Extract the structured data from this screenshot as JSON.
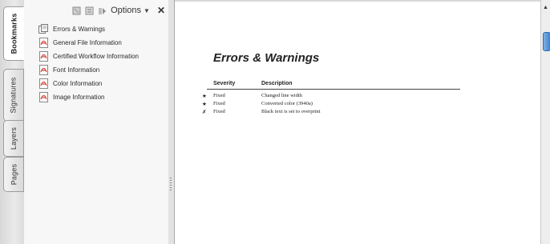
{
  "tabs": [
    {
      "label": "Bookmarks",
      "active": true
    },
    {
      "label": "Signatures",
      "active": false
    },
    {
      "label": "Layers",
      "active": false
    },
    {
      "label": "Pages",
      "active": false
    }
  ],
  "panel": {
    "options_label": "Options",
    "bookmarks": [
      {
        "label": "Errors & Warnings",
        "icon": "bookmark-pages-icon"
      },
      {
        "label": "General File Information",
        "icon": "bookmark-pdf-icon"
      },
      {
        "label": "Certified Workflow Information",
        "icon": "bookmark-pdf-icon"
      },
      {
        "label": "Font Information",
        "icon": "bookmark-pdf-icon"
      },
      {
        "label": "Color Information",
        "icon": "bookmark-pdf-icon"
      },
      {
        "label": "Image Information",
        "icon": "bookmark-pdf-icon"
      }
    ]
  },
  "document": {
    "title": "Errors & Warnings",
    "headers": {
      "severity": "Severity",
      "description": "Description"
    },
    "rows": [
      {
        "mark": "★",
        "severity": "Fixed",
        "description": "Changed line width"
      },
      {
        "mark": "★",
        "severity": "Fixed",
        "description": "Converted color (3940a)"
      },
      {
        "mark": "✗",
        "severity": "Fixed",
        "description": "Black text is set to overprint"
      }
    ]
  },
  "colors": {
    "accent": "#3c83cf",
    "pdf_icon": "#d04a3a"
  }
}
